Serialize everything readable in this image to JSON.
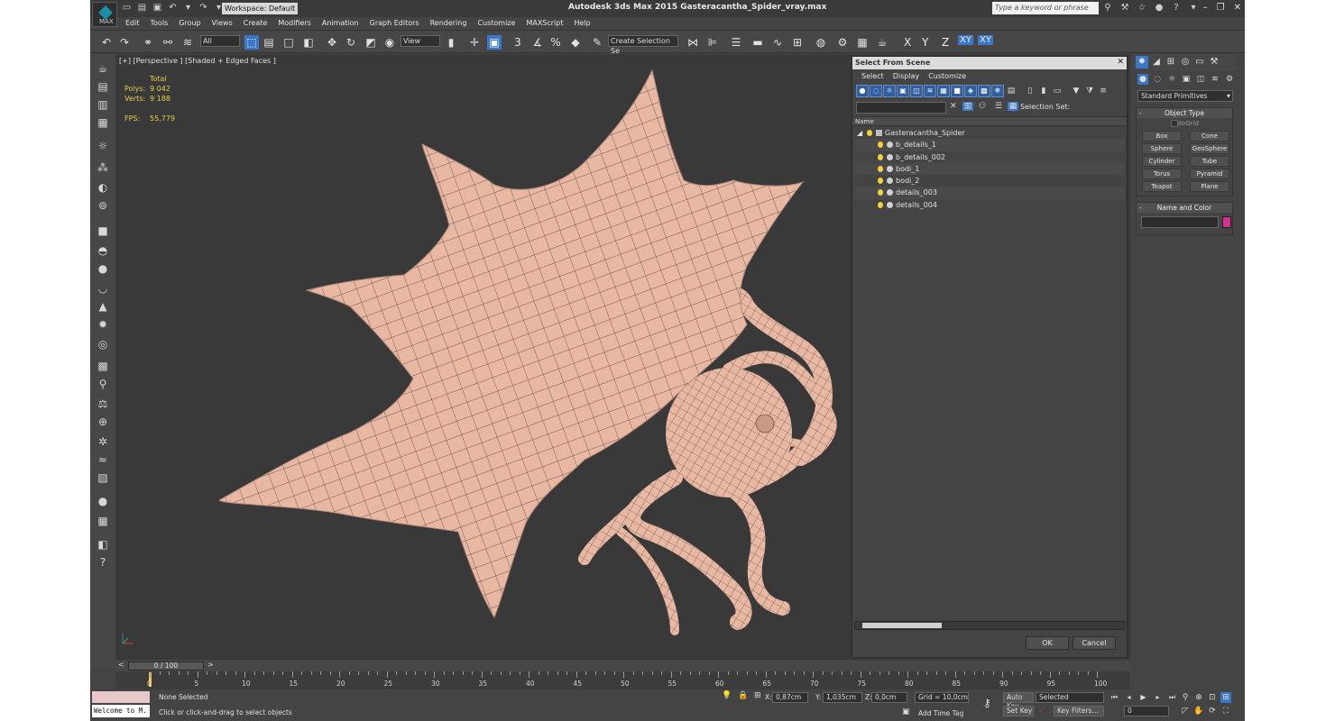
{
  "app": {
    "title": "Autodesk 3ds Max  2015    Gasteracantha_Spider_vray.max",
    "logo_text": "MAX",
    "workspace": "Workspace: Default",
    "search_placeholder": "Type a keyword or phrase"
  },
  "menu": [
    "Edit",
    "Tools",
    "Group",
    "Views",
    "Create",
    "Modifiers",
    "Animation",
    "Graph Editors",
    "Rendering",
    "Customize",
    "MAXScript",
    "Help"
  ],
  "toolbar": {
    "filter": "All",
    "ref_coord": "View",
    "selection_set_placeholder": "Create Selection Se",
    "axes": [
      "X",
      "Y",
      "Z",
      "XY",
      "XY"
    ]
  },
  "viewport": {
    "label": "[+] [Perspective ] [Shaded + Edged Faces ]",
    "stats": {
      "total_label": "Total",
      "polys_label": "Polys:",
      "polys": "9 042",
      "verts_label": "Verts:",
      "verts": "9 188",
      "fps_label": "FPS:",
      "fps": "55,779"
    },
    "mesh_color": "#e9b8a3",
    "background": "#393939"
  },
  "scene_explorer": {
    "title": "Select From Scene",
    "menus": [
      "Select",
      "Display",
      "Customize"
    ],
    "selection_set_label": "Selection Set:",
    "column_name": "Name",
    "root": "Gasteracantha_Spider",
    "items": [
      "b_details_1",
      "b_details_002",
      "bodi_1",
      "bodi_2",
      "details_003",
      "details_004"
    ],
    "ok": "OK",
    "cancel": "Cancel"
  },
  "command_panel": {
    "category": "Standard Primitives",
    "object_type_title": "Object Type",
    "autogrid": "AutoGrid",
    "primitives": [
      "Box",
      "Cone",
      "Sphere",
      "GeoSphere",
      "Cylinder",
      "Tube",
      "Torus",
      "Pyramid",
      "Teapot",
      "Plane"
    ],
    "name_color_title": "Name and Color",
    "swatch_color": "#d6328a"
  },
  "timeline": {
    "slider": "0 / 100",
    "ticks": [
      "0",
      "5",
      "10",
      "15",
      "20",
      "25",
      "30",
      "35",
      "40",
      "45",
      "50",
      "55",
      "60",
      "65",
      "70",
      "75",
      "80",
      "85",
      "90",
      "95",
      "100"
    ]
  },
  "status": {
    "welcome": "Welcome to M.",
    "selection": "None Selected",
    "prompt": "Click or click-and-drag to select objects",
    "x_label": "X:",
    "x": "0,87cm",
    "y_label": "Y:",
    "y": "1,035cm",
    "z_label": "Z:",
    "z": "0,0cm",
    "grid": "Grid = 10,0cm",
    "add_time_tag": "Add Time Tag",
    "auto_key": "Auto Key",
    "set_key": "Set Key",
    "selected": "Selected",
    "key_filters": "Key Filters...",
    "frame": "0"
  }
}
